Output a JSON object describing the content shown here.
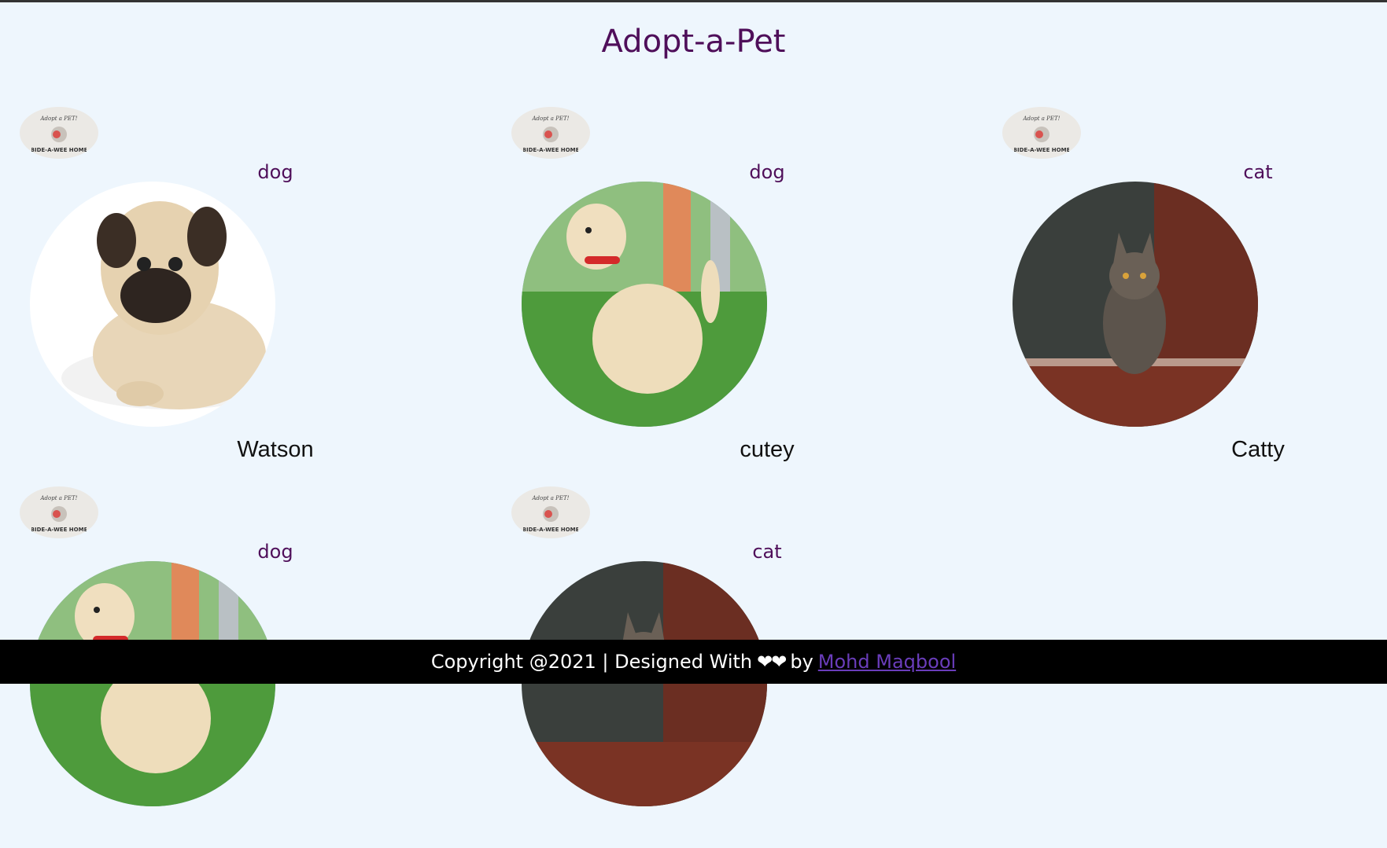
{
  "header": {
    "title": "Adopt-a-Pet"
  },
  "logo_icon": "bide-a-wee-home-logo",
  "pets": [
    {
      "type": "dog",
      "name": "Watson",
      "photo": "pug-icon"
    },
    {
      "type": "dog",
      "name": "cutey",
      "photo": "golden-puppy-icon"
    },
    {
      "type": "cat",
      "name": "Catty",
      "photo": "tabby-cat-icon"
    },
    {
      "type": "dog",
      "name": "",
      "photo": "golden-puppy-icon"
    },
    {
      "type": "cat",
      "name": "",
      "photo": "tabby-cat-icon"
    }
  ],
  "footer": {
    "text": "Copyright @2021 | Designed With",
    "hearts": "❤❤",
    "by": "by",
    "author": "Mohd Maqbool"
  },
  "colors": {
    "background": "#eef6fd",
    "title": "#4f0f5a",
    "footer_bg": "#000000",
    "link": "#6a3dbb"
  }
}
